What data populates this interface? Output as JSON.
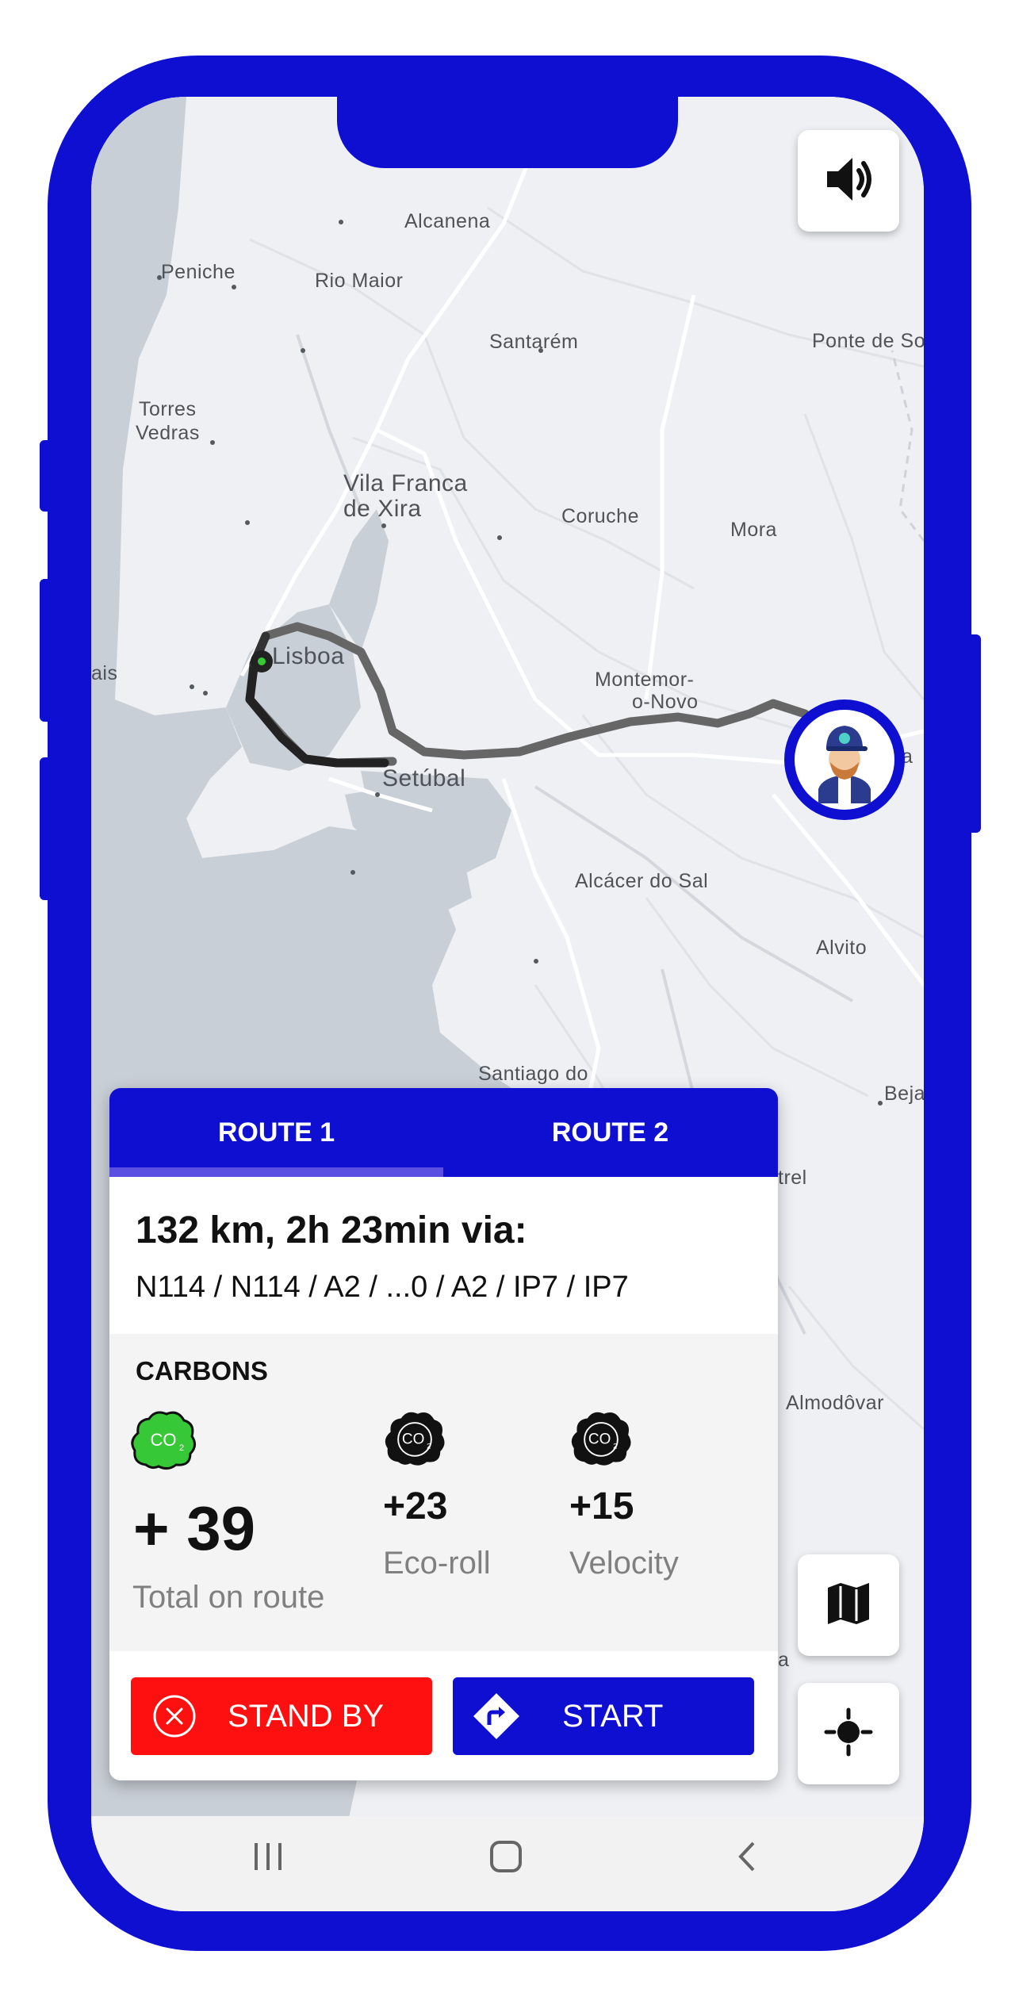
{
  "map": {
    "cities": [
      {
        "name": "Alcanena"
      },
      {
        "name": "Peniche"
      },
      {
        "name": "Rio Maior"
      },
      {
        "name": "Santarém"
      },
      {
        "name": "Ponte de So"
      },
      {
        "name": "Torres"
      },
      {
        "name": "Vedras"
      },
      {
        "name": "Vila Franca"
      },
      {
        "name": "de Xira"
      },
      {
        "name": "Coruche"
      },
      {
        "name": "Mora"
      },
      {
        "name": "Lisboa"
      },
      {
        "name": "ais"
      },
      {
        "name": "Montemor-"
      },
      {
        "name": "o-Novo"
      },
      {
        "name": "a"
      },
      {
        "name": "Setúbal"
      },
      {
        "name": "Alcácer do Sal"
      },
      {
        "name": "Alvito"
      },
      {
        "name": "Santiago do"
      },
      {
        "name": "Beja"
      },
      {
        "name": "trel"
      },
      {
        "name": "Almodôvar"
      },
      {
        "name": "a"
      }
    ]
  },
  "controls": {
    "sound_icon": "speaker-volume-icon",
    "map_icon": "folded-map-icon",
    "locate_icon": "gps-locate-icon",
    "driver_avatar": "driver-avatar-icon"
  },
  "route_card": {
    "tabs": [
      {
        "label": "ROUTE 1",
        "active": true
      },
      {
        "label": "ROUTE 2",
        "active": false
      }
    ],
    "summary": "132 km, 2h 23min via:",
    "roads": "N114 / N114 / A2 / ...0 / A2 / IP7 / IP7",
    "carbons": {
      "title": "CARBONS",
      "total": {
        "value": "+ 39",
        "label": "Total on route",
        "icon_color": "#37c837"
      },
      "eco_roll": {
        "value": "+23",
        "label": "Eco-roll",
        "icon_color": "#000000"
      },
      "velocity": {
        "value": "+15",
        "label": "Velocity",
        "icon_color": "#000000"
      },
      "co2_glyph": "CO2"
    },
    "stand_by_label": "STAND BY",
    "start_label": "START"
  },
  "colors": {
    "brand_blue": "#0f0fd2",
    "stand_by_red": "#ff1010",
    "eco_green": "#37c837"
  },
  "navbar": [
    "recent-apps-icon",
    "home-icon",
    "back-icon"
  ]
}
